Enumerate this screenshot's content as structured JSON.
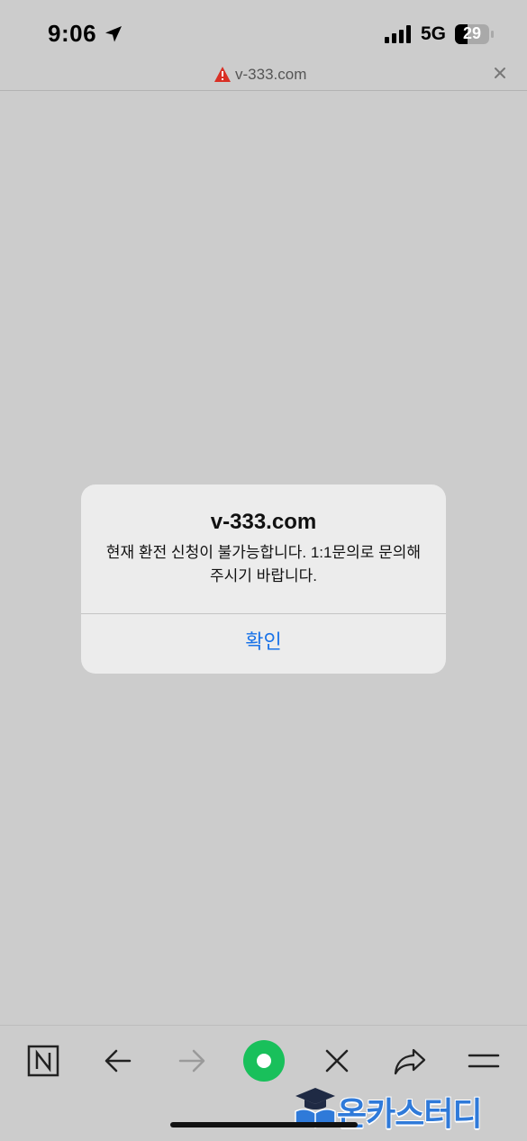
{
  "status_bar": {
    "time": "9:06",
    "network": "5G",
    "battery": "29",
    "icons": [
      "location-arrow-icon",
      "signal-icon",
      "battery-icon"
    ]
  },
  "url_bar": {
    "url": "v-333.com",
    "warning_color": "#d93025",
    "icons": [
      "warning-icon",
      "close-icon"
    ]
  },
  "dialog": {
    "title": "v-333.com",
    "message": "현재 환전 신청이 불가능합니다. 1:1문의로 문의해 주시기 바랍니다.",
    "confirm_label": "확인",
    "button_color": "#1a73e8"
  },
  "toolbar": {
    "icons": [
      "naver-n-icon",
      "back-arrow-icon",
      "forward-arrow-icon",
      "green-dot-icon",
      "close-x-icon",
      "share-icon",
      "menu-icon"
    ],
    "accent": "#19c05b"
  },
  "watermark": {
    "text": "온카스터디"
  }
}
